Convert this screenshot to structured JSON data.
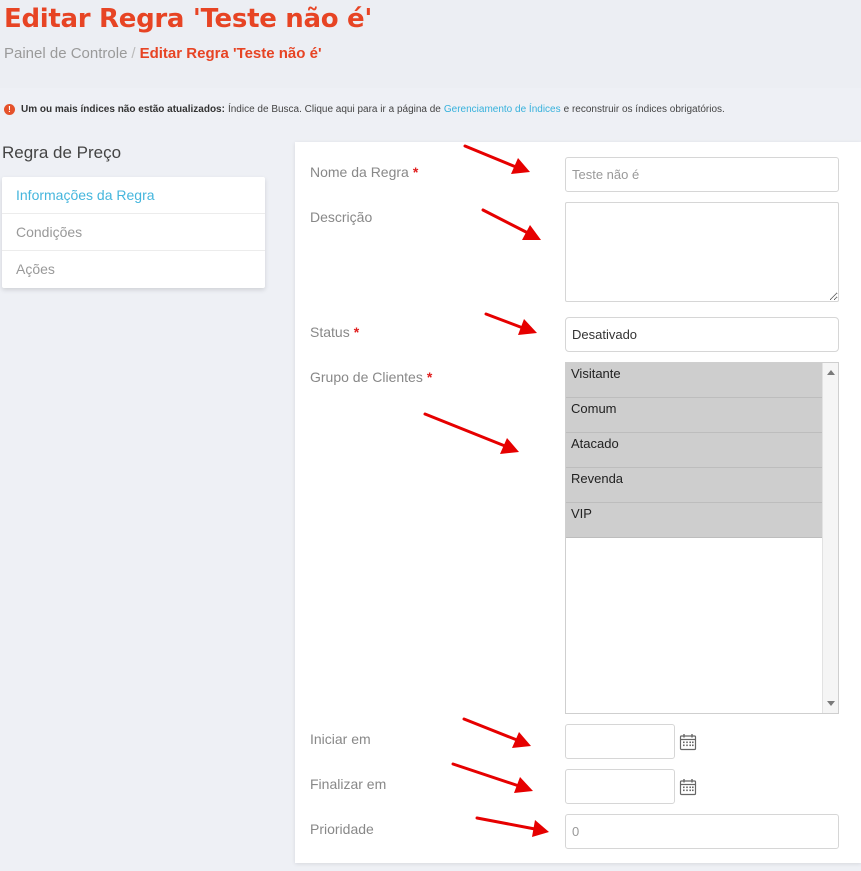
{
  "header": {
    "title": "Editar Regra 'Teste não é'",
    "breadcrumb": {
      "home": "Painel de Controle",
      "separator": "/",
      "current": "Editar Regra 'Teste não é'"
    }
  },
  "alert": {
    "icon": "alert-circle-icon",
    "bold": "Um ou mais índices não estão atualizados:",
    "text_before": "Índice de Busca. Clique aqui para ir a página de",
    "link": "Gerenciamento de Índices",
    "text_after": "e reconstruir os índices obrigatórios."
  },
  "sidebar": {
    "title": "Regra de Preço",
    "items": [
      {
        "label": "Informações da Regra",
        "active": true
      },
      {
        "label": "Condições",
        "active": false
      },
      {
        "label": "Ações",
        "active": false
      }
    ]
  },
  "form": {
    "required_mark": "*",
    "rule_name": {
      "label": "Nome da Regra",
      "value": "Teste não é"
    },
    "description": {
      "label": "Descrição",
      "value": ""
    },
    "status": {
      "label": "Status",
      "value": "Desativado"
    },
    "customer_groups": {
      "label": "Grupo de Clientes",
      "options": [
        "Visitante",
        "Comum",
        "Atacado",
        "Revenda",
        "VIP"
      ]
    },
    "start_date": {
      "label": "Iniciar em",
      "value": ""
    },
    "end_date": {
      "label": "Finalizar em",
      "value": ""
    },
    "priority": {
      "label": "Prioridade",
      "value": "0"
    }
  },
  "colors": {
    "accent": "#e74424",
    "link": "#36b1dc",
    "annotation_arrows": "#e60000"
  }
}
